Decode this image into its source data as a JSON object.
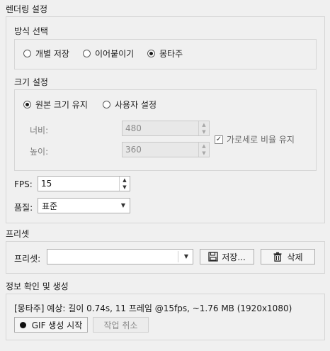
{
  "render_settings": {
    "title": "렌더링 설정"
  },
  "method": {
    "title": "방식 선택",
    "options": [
      "개별 저장",
      "이어붙이기",
      "몽타주"
    ],
    "selected": "몽타주"
  },
  "size": {
    "title": "크기 설정",
    "options": [
      "원본 크기 유지",
      "사용자 설정"
    ],
    "selected": "원본 크기 유지",
    "width_label": "너비:",
    "width_value": "480",
    "height_label": "높이:",
    "height_value": "360",
    "keep_ratio_label": "가로세로 비율 유지",
    "keep_ratio_checked": true
  },
  "fps": {
    "label": "FPS:",
    "value": "15"
  },
  "quality": {
    "label": "품질:",
    "value": "표준"
  },
  "preset": {
    "section_title": "프리셋",
    "label": "프리셋:",
    "value": "",
    "save_label": "저장...",
    "delete_label": "삭제"
  },
  "info": {
    "section_title": "정보 확인 및 생성",
    "summary": "[몽타주] 예상: 길이 0.74s, 11 프레임 @15fps, ~1.76 MB (1920x1080)",
    "start_label": "GIF 생성 시작",
    "cancel_label": "작업 취소"
  }
}
